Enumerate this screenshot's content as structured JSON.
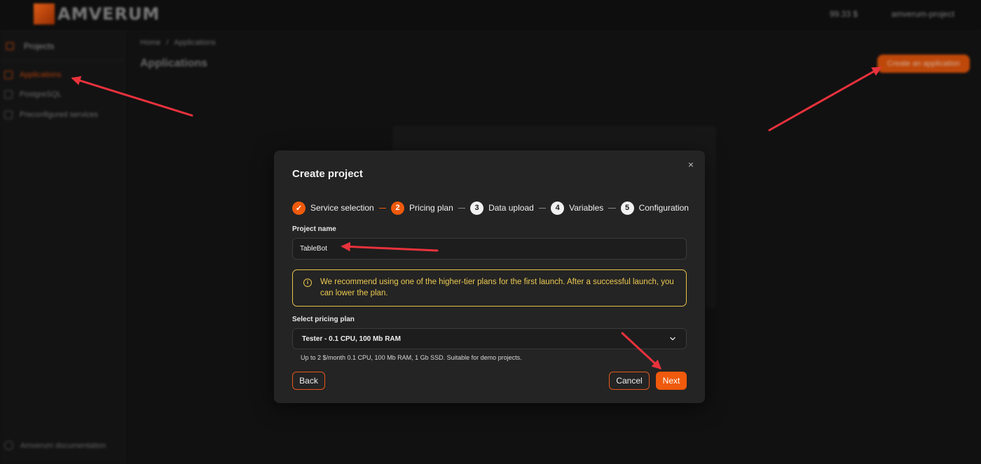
{
  "topbar": {
    "logo_text": "AMVERUM",
    "balance": "99.33 $",
    "account": "amverum-project"
  },
  "sidebar": {
    "projects_label": "Projects",
    "items": [
      {
        "label": "Applications",
        "active": true
      },
      {
        "label": "PostgreSQL",
        "active": false
      },
      {
        "label": "Preconfigured services",
        "active": false
      }
    ],
    "docs_label": "Amverum documentation"
  },
  "main": {
    "breadcrumb": [
      "Home",
      "/",
      "Applications"
    ],
    "title": "Applications",
    "create_button": "Create an application"
  },
  "modal": {
    "title": "Create project",
    "close_icon": "×",
    "steps": [
      {
        "number": "✓",
        "label": "Service selection",
        "status": "done"
      },
      {
        "number": "2",
        "label": "Pricing plan",
        "status": "current"
      },
      {
        "number": "3",
        "label": "Data upload",
        "status": "upcoming"
      },
      {
        "number": "4",
        "label": "Variables",
        "status": "upcoming"
      },
      {
        "number": "5",
        "label": "Configuration",
        "status": "upcoming"
      }
    ],
    "project_name_label": "Project name",
    "project_name_value": "TableBot",
    "alert_icon": "info-icon",
    "alert_text": "We recommend using one of the higher-tier plans for the first launch. After a successful launch, you can lower the plan.",
    "pricing_label": "Select pricing plan",
    "pricing_selected": "Tester - 0.1 CPU, 100 Mb RAM",
    "pricing_hint": "Up to 2 $/month 0.1 CPU, 100 Mb RAM, 1 Gb SSD. Suitable for demo projects.",
    "back_button": "Back",
    "cancel_button": "Cancel",
    "next_button": "Next"
  },
  "colors": {
    "accent": "#ef5a0c",
    "warning": "#ecca52",
    "annotation_arrow": "#e8323c"
  }
}
